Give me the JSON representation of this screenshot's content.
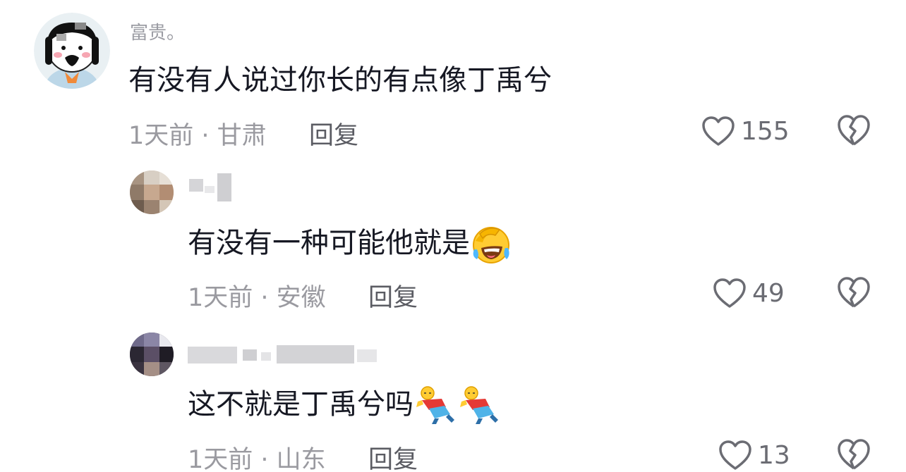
{
  "comments": [
    {
      "username": "富贵。",
      "text": "有没有人说过你长的有点像丁禹兮",
      "time": "1天前",
      "location": "甘肃",
      "reply_label": "回复",
      "likes": "155"
    },
    {
      "username": "",
      "text": "有没有一种可能他就是",
      "emoji": "face-with-tears-of-joy",
      "time": "1天前",
      "location": "安徽",
      "reply_label": "回复",
      "likes": "49"
    },
    {
      "username": "",
      "text": "这不就是丁禹兮吗",
      "emoji": "rolling-cartoon-figure",
      "time": "1天前",
      "location": "山东",
      "reply_label": "回复",
      "likes": "13"
    }
  ],
  "separator": " · ",
  "icons": {
    "like": "heart-outline-icon",
    "dislike": "broken-heart-icon"
  },
  "colors": {
    "text": "#161823",
    "secondary": "#9a9aa0",
    "reply": "#5b5c63"
  }
}
